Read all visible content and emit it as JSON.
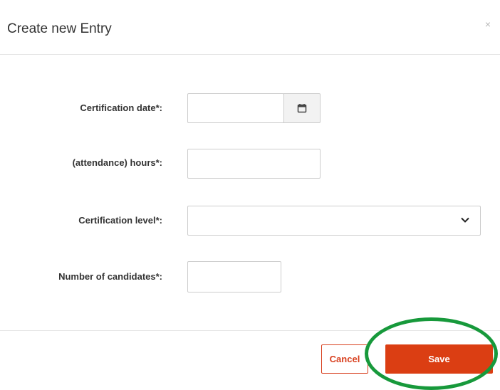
{
  "modal": {
    "title": "Create new Entry",
    "close_label": "×"
  },
  "form": {
    "certification_date": {
      "label": "Certification date*:",
      "value": "",
      "icon": "calendar-icon"
    },
    "attendance_hours": {
      "label": "(attendance) hours*:",
      "value": ""
    },
    "certification_level": {
      "label": "Certification level*:",
      "selected": "",
      "icon": "chevron-down-icon"
    },
    "number_of_candidates": {
      "label": "Number of candidates*:",
      "value": ""
    }
  },
  "footer": {
    "cancel_label": "Cancel",
    "save_label": "Save"
  },
  "colors": {
    "primary": "#db3e13",
    "highlight": "#17993b",
    "border": "#cccccc"
  }
}
